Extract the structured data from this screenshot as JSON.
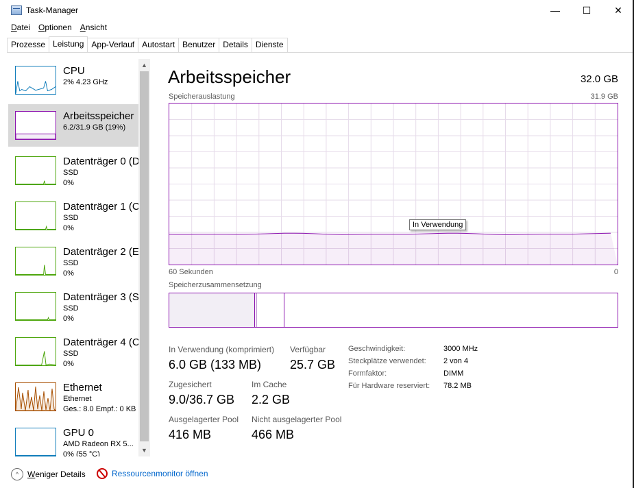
{
  "window": {
    "title": "Task-Manager",
    "controls": {
      "minimize": "—",
      "maximize": "☐",
      "close": "✕"
    }
  },
  "menu": {
    "items": [
      {
        "label_first": "D",
        "label_rest": "atei"
      },
      {
        "label_first": "O",
        "label_rest": "ptionen"
      },
      {
        "label_first": "A",
        "label_rest": "nsicht"
      }
    ]
  },
  "tabs": [
    "Prozesse",
    "Leistung",
    "App-Verlauf",
    "Autostart",
    "Benutzer",
    "Details",
    "Dienste"
  ],
  "active_tab": "Leistung",
  "sidebar": {
    "items": [
      {
        "name": "CPU",
        "sub1": "2% 4.23 GHz",
        "sub2": "",
        "color": "#117dbb"
      },
      {
        "name": "Arbeitsspeicher",
        "sub1": "6.2/31.9 GB (19%)",
        "sub2": "",
        "color": "#8b12ae",
        "selected": true
      },
      {
        "name": "Datenträger 0 (D",
        "sub1": "SSD",
        "sub2": "0%",
        "color": "#4da60c"
      },
      {
        "name": "Datenträger 1 (C",
        "sub1": "SSD",
        "sub2": "0%",
        "color": "#4da60c"
      },
      {
        "name": "Datenträger 2 (E",
        "sub1": "SSD",
        "sub2": "0%",
        "color": "#4da60c"
      },
      {
        "name": "Datenträger 3 (S",
        "sub1": "SSD",
        "sub2": "0%",
        "color": "#4da60c"
      },
      {
        "name": "Datenträger 4 (C",
        "sub1": "SSD",
        "sub2": "0%",
        "color": "#4da60c"
      },
      {
        "name": "Ethernet",
        "sub1": "Ethernet",
        "sub2": "Ges.: 8.0 Empf.: 0 KB",
        "color": "#a74f01"
      },
      {
        "name": "GPU 0",
        "sub1": "AMD Radeon RX 5...",
        "sub2": "0% (55 °C)",
        "color": "#117dbb"
      }
    ]
  },
  "main": {
    "title": "Arbeitsspeicher",
    "total": "32.0 GB",
    "graph_label": "Speicherauslastung",
    "graph_max": "31.9 GB",
    "graph_time": "60 Sekunden",
    "graph_min": "0",
    "tooltip": "In Verwendung",
    "usage_fraction": 0.19,
    "composition_label": "Speicherzusammensetzung",
    "stats": {
      "in_use_label": "In Verwendung (komprimiert)",
      "in_use_value": "6.0 GB (133 MB)",
      "available_label": "Verfügbar",
      "available_value": "25.7 GB",
      "committed_label": "Zugesichert",
      "committed_value": "9.0/36.7 GB",
      "cached_label": "Im Cache",
      "cached_value": "2.2 GB",
      "paged_label": "Ausgelagerter Pool",
      "paged_value": "416 MB",
      "nonpaged_label": "Nicht ausgelagerter Pool",
      "nonpaged_value": "466 MB"
    },
    "info": [
      {
        "k": "Geschwindigkeit:",
        "v": "3000 MHz"
      },
      {
        "k": "Steckplätze verwendet:",
        "v": "2 von 4"
      },
      {
        "k": "Formfaktor:",
        "v": "DIMM"
      },
      {
        "k": "Für Hardware reserviert:",
        "v": "78.2 MB"
      }
    ]
  },
  "footer": {
    "fewer_details_first": "W",
    "fewer_details_rest": "eniger Details",
    "resource_monitor": "Ressourcenmonitor öffnen"
  },
  "icons": {
    "chevron_up": "▲",
    "chevron_down": "▼",
    "fewer_details": "^"
  }
}
